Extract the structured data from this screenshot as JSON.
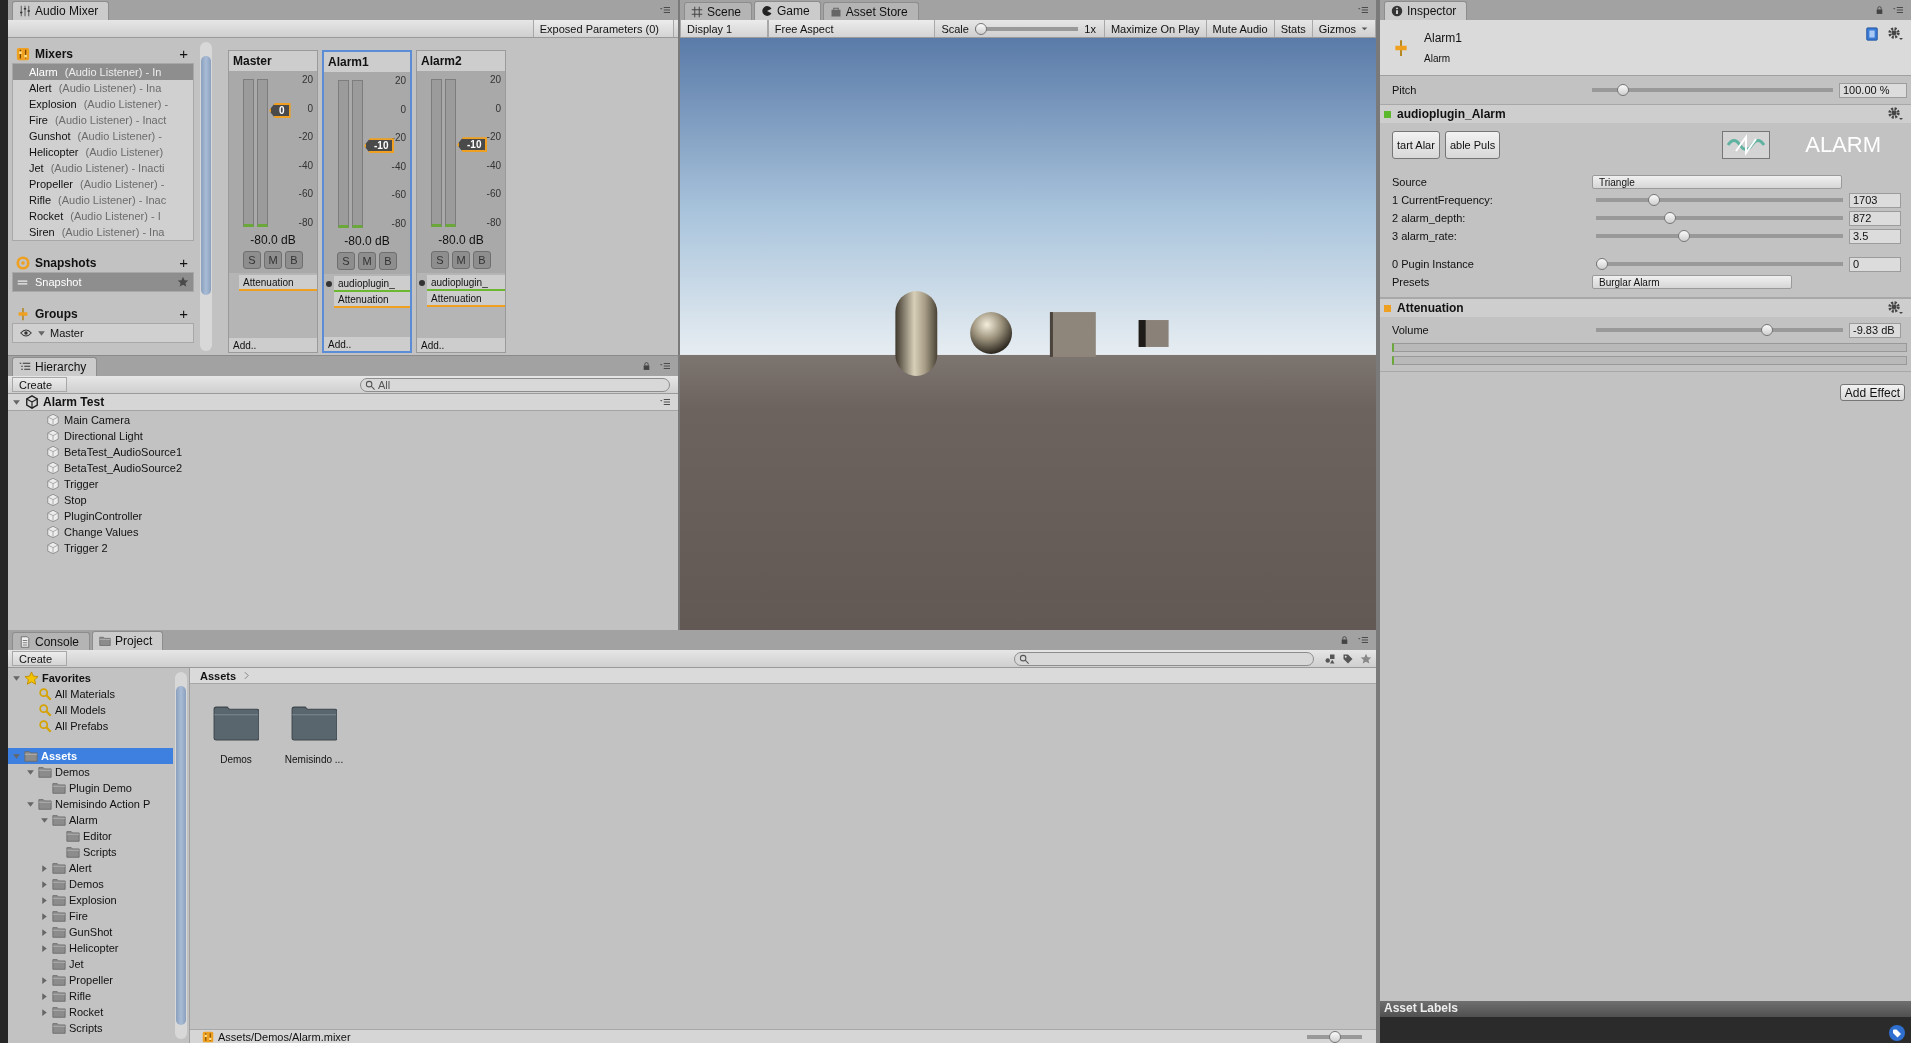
{
  "audio_mixer": {
    "tab": "Audio Mixer",
    "exposed_parameters": "Exposed Parameters (0)",
    "mixers": {
      "title": "Mixers",
      "add": "+",
      "items": [
        {
          "name": "Alarm",
          "detail": "(Audio Listener) - In",
          "selected": true
        },
        {
          "name": "Alert",
          "detail": "(Audio Listener) - Ina",
          "selected": false
        },
        {
          "name": "Explosion",
          "detail": "(Audio Listener) -",
          "selected": false
        },
        {
          "name": "Fire",
          "detail": "(Audio Listener) - Inact",
          "selected": false
        },
        {
          "name": "Gunshot",
          "detail": "(Audio Listener) -",
          "selected": false
        },
        {
          "name": "Helicopter",
          "detail": "(Audio Listener)",
          "selected": false
        },
        {
          "name": "Jet",
          "detail": "(Audio Listener) - Inacti",
          "selected": false
        },
        {
          "name": "Propeller",
          "detail": "(Audio Listener) -",
          "selected": false
        },
        {
          "name": "Rifle",
          "detail": "(Audio Listener) - Inac",
          "selected": false
        },
        {
          "name": "Rocket",
          "detail": "(Audio Listener) - I",
          "selected": false
        },
        {
          "name": "Siren",
          "detail": "(Audio Listener) - Ina",
          "selected": false
        }
      ]
    },
    "snapshots": {
      "title": "Snapshots",
      "add": "+",
      "items": [
        {
          "name": "Snapshot",
          "selected": true,
          "starred": true
        }
      ]
    },
    "groups": {
      "title": "Groups",
      "add": "+",
      "items": [
        {
          "name": "Master",
          "visible": true,
          "expanded": true
        }
      ]
    },
    "strips": [
      {
        "name": "Master",
        "selected": false,
        "scale": [
          "20",
          "0",
          "-20",
          "-40",
          "-60",
          "-80"
        ],
        "fader": "0",
        "level": 0.75,
        "reading": "-80.0 dB",
        "buttons": [
          "S",
          "M",
          "B"
        ],
        "effects": [
          {
            "name": "Attenuation",
            "color": "#f0a020",
            "indicator": false
          }
        ],
        "add": "Add.."
      },
      {
        "name": "Alarm1",
        "selected": true,
        "scale": [
          "20",
          "0",
          "-20",
          "-40",
          "-60",
          "-80"
        ],
        "fader": "-10",
        "level": 0.53,
        "reading": "-80.0 dB",
        "buttons": [
          "S",
          "M",
          "B"
        ],
        "effects": [
          {
            "name": "audioplugin_",
            "color": "#6cb830",
            "indicator": true
          },
          {
            "name": "Attenuation",
            "color": "#f0a020",
            "indicator": false
          }
        ],
        "add": "Add.."
      },
      {
        "name": "Alarm2",
        "selected": false,
        "scale": [
          "20",
          "0",
          "-20",
          "-40",
          "-60",
          "-80"
        ],
        "fader": "-10",
        "level": 0.53,
        "reading": "-80.0 dB",
        "buttons": [
          "S",
          "M",
          "B"
        ],
        "effects": [
          {
            "name": "audioplugin_",
            "color": "#6cb830",
            "indicator": true
          },
          {
            "name": "Attenuation",
            "color": "#f0a020",
            "indicator": false
          }
        ],
        "add": "Add.."
      }
    ]
  },
  "hierarchy": {
    "tab": "Hierarchy",
    "create": "Create",
    "search_placeholder": "All",
    "scene": {
      "name": "Alarm Test",
      "expanded": true,
      "children": [
        {
          "name": "Main Camera",
          "selected": false
        },
        {
          "name": "Directional Light",
          "selected": false
        },
        {
          "name": "BetaTest_AudioSource1",
          "selected": false
        },
        {
          "name": "BetaTest_AudioSource2",
          "selected": false
        },
        {
          "name": "Trigger",
          "selected": false
        },
        {
          "name": "Stop",
          "selected": false
        },
        {
          "name": "PluginController",
          "selected": false
        },
        {
          "name": "Change Values",
          "selected": false
        },
        {
          "name": "Trigger 2",
          "selected": false
        }
      ]
    }
  },
  "game": {
    "tabs": [
      {
        "label": "Scene",
        "selected": false
      },
      {
        "label": "Game",
        "selected": true
      },
      {
        "label": "Asset Store",
        "selected": false
      }
    ],
    "display": "Display 1",
    "aspect": "Free Aspect",
    "scale": {
      "label": "Scale",
      "level": 0,
      "reading": "1x"
    },
    "toggles": [
      {
        "label": "Maximize On Play",
        "on": false,
        "kind": "toggle"
      },
      {
        "label": "Mute Audio",
        "on": false,
        "kind": "toggle"
      },
      {
        "label": "Stats",
        "on": false,
        "kind": "toggle"
      },
      {
        "label": "Gizmos",
        "on": false,
        "kind": "dropdown"
      }
    ]
  },
  "inspector": {
    "tab": "Inspector",
    "title": "Alarm1",
    "subtitle": "Alarm",
    "pitch": {
      "label": "Pitch",
      "level": 0.11,
      "value": "100.00 %"
    },
    "effects": [
      {
        "name": "audioplugin_Alarm",
        "color": "#5cb82c",
        "buttons": [
          "tart Alar",
          "able Puls"
        ],
        "logo": "ALARM",
        "param_groups": [
          [
            {
              "kind": "dropdown",
              "label": "Source",
              "value": "Triangle"
            },
            {
              "kind": "slider",
              "label": "1 CurrentFrequency:",
              "level": 0.22,
              "value": "1703"
            },
            {
              "kind": "slider",
              "label": "2 alarm_depth:",
              "level": 0.29,
              "value": "872"
            },
            {
              "kind": "slider",
              "label": "3 alarm_rate:",
              "level": 0.35,
              "value": "3.5"
            }
          ],
          [
            {
              "kind": "slider",
              "label": "0 Pugin Instance",
              "level": 0,
              "value": "0"
            },
            {
              "kind": "dropdown",
              "label": "Presets",
              "value": "Burglar Alarm"
            }
          ]
        ]
      },
      {
        "name": "Attenuation",
        "color": "#f0a020",
        "param_groups": [
          [
            {
              "kind": "slider",
              "label": "Volume",
              "level": 0.7,
              "value": "-9.83 dB"
            },
            {
              "kind": "meter"
            },
            {
              "kind": "meter"
            }
          ]
        ]
      }
    ],
    "add_effect": "Add Effect",
    "asset_labels": "Asset Labels"
  },
  "project": {
    "tabs": [
      {
        "label": "Console",
        "selected": false
      },
      {
        "label": "Project",
        "selected": true
      }
    ],
    "create": "Create",
    "tree": [
      {
        "name": "Favorites",
        "kind": "favorites",
        "selected": false,
        "expanded": true,
        "children": [
          {
            "name": "All Materials",
            "kind": "search",
            "selected": false
          },
          {
            "name": "All Models",
            "kind": "search",
            "selected": false
          },
          {
            "name": "All Prefabs",
            "kind": "search",
            "selected": false
          }
        ]
      },
      {
        "name": "Assets",
        "kind": "folder",
        "selected": true,
        "expanded": true,
        "children": [
          {
            "name": "Demos",
            "kind": "folder",
            "selected": false,
            "expanded": true,
            "children": [
              {
                "name": "Plugin Demo",
                "kind": "folder",
                "selected": false
              }
            ]
          },
          {
            "name": "Nemisindo Action P",
            "kind": "folder",
            "selected": false,
            "expanded": true,
            "children": [
              {
                "name": "Alarm",
                "kind": "folder",
                "selected": false,
                "expanded": true,
                "children": [
                  {
                    "name": "Editor",
                    "kind": "folder",
                    "selected": false
                  },
                  {
                    "name": "Scripts",
                    "kind": "folder",
                    "selected": false
                  }
                ]
              },
              {
                "name": "Alert",
                "kind": "folder",
                "selected": false,
                "expanded": false
              },
              {
                "name": "Demos",
                "kind": "folder",
                "selected": false,
                "expanded": false
              },
              {
                "name": "Explosion",
                "kind": "folder",
                "selected": false,
                "expanded": false
              },
              {
                "name": "Fire",
                "kind": "folder",
                "selected": false,
                "expanded": false
              },
              {
                "name": "GunShot",
                "kind": "folder",
                "selected": false,
                "expanded": false
              },
              {
                "name": "Helicopter",
                "kind": "folder",
                "selected": false,
                "expanded": false
              },
              {
                "name": "Jet",
                "kind": "folder",
                "selected": false
              },
              {
                "name": "Propeller",
                "kind": "folder",
                "selected": false,
                "expanded": false
              },
              {
                "name": "Rifle",
                "kind": "folder",
                "selected": false,
                "expanded": false
              },
              {
                "name": "Rocket",
                "kind": "folder",
                "selected": false,
                "expanded": false
              },
              {
                "name": "Scripts",
                "kind": "folder",
                "selected": false
              }
            ]
          }
        ]
      }
    ],
    "breadcrumb": "Assets",
    "items": [
      {
        "name": "Demos",
        "selected": false
      },
      {
        "name": "Nemisindo ...",
        "selected": false
      }
    ],
    "path": "Assets/Demos/Alarm.mixer",
    "zoom": {
      "level": 0.5
    }
  }
}
